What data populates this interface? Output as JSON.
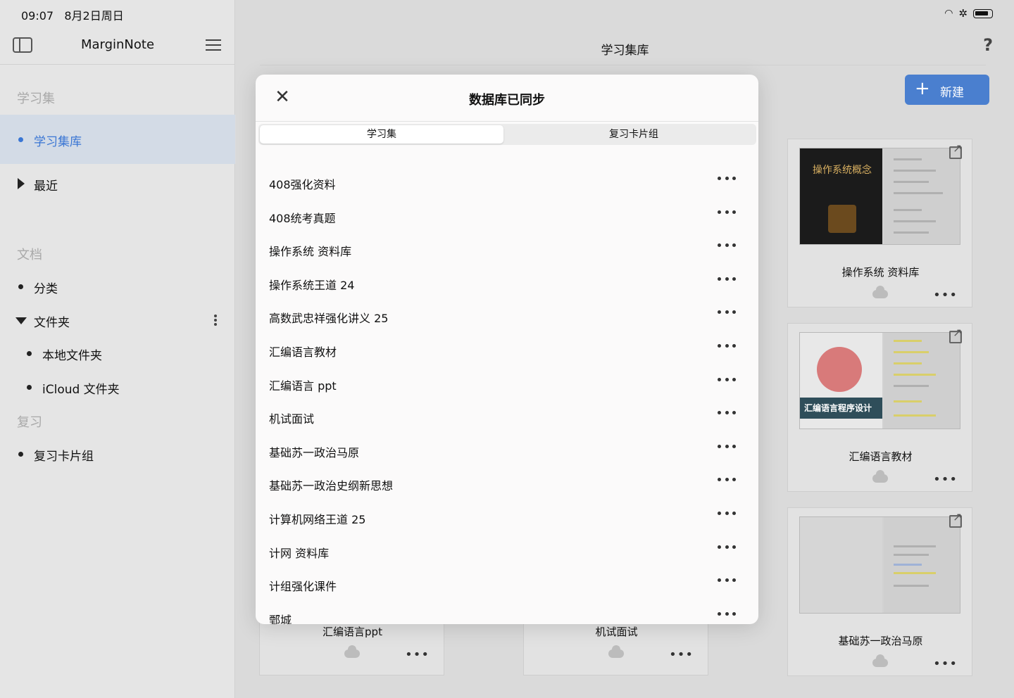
{
  "status": {
    "time": "09:07",
    "date": "8月2日周日"
  },
  "sidebar": {
    "title": "MarginNote",
    "section_notebooks": "学习集",
    "notebook_library": "学习集库",
    "recent": "最近",
    "section_documents": "文档",
    "categories": "分类",
    "folders": "文件夹",
    "local_folder": "本地文件夹",
    "icloud_folder": "iCloud 文件夹",
    "section_review": "复习",
    "review_cards": "复习卡片组"
  },
  "main": {
    "title": "学习集库",
    "help": "?",
    "new_button": "新建",
    "cards": [
      {
        "name": "操作系统 资料库"
      },
      {
        "name": "汇编语言教材"
      },
      {
        "name": "基础苏一政治马原"
      },
      {
        "name": "汇编语言ppt"
      },
      {
        "name": "机试面试"
      }
    ],
    "thumb_texts": {
      "os_cover": "操作系统概念",
      "asm_cover": "汇编语言程序设计"
    }
  },
  "modal": {
    "title": "数据库已同步",
    "tabs": [
      "学习集",
      "复习卡片组"
    ],
    "items": [
      "408强化资料",
      "408统考真题",
      "操作系统 资料库",
      "操作系统王道 24",
      "高数武忠祥强化讲义 25",
      "汇编语言教材",
      "汇编语言 ppt",
      "机试面试",
      "基础苏一政治马原",
      "基础苏一政治史纲新思想",
      "计算机网络王道 25",
      "计网 资料库",
      "计组强化课件",
      "鄄城"
    ]
  },
  "colors": {
    "accent": "#3a76d4",
    "new_button": "#4a7fcf"
  }
}
